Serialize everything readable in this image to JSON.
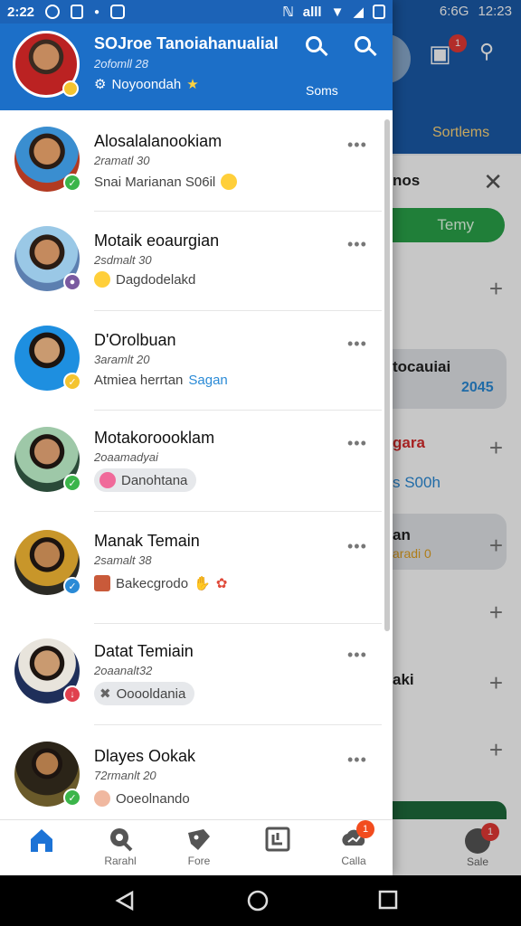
{
  "status_bar": {
    "time": "2:22",
    "right_text": "alll",
    "bg_time": "12:23",
    "bg_signal": "6:6G"
  },
  "header": {
    "title": "SOJroe Tanoiahanualial",
    "subtitle": "2ofomll 28",
    "status": "Noyoondah",
    "sort_label": "Soms"
  },
  "background": {
    "sort_label": "Sortlems",
    "panel_title": "nos",
    "green_pill": "Temy",
    "rows": [
      "tocauiai",
      "gara",
      "s S00h",
      "an",
      "aki"
    ],
    "row_years": [
      "2045",
      "aradi 0"
    ],
    "nav_label": "Sale",
    "badge_count": "1",
    "nav_badge": "1"
  },
  "chats": [
    {
      "name": "Alosalalanookiam",
      "time": "2ramatl 30",
      "preview": "Snai Marianan S06il",
      "preview_emoji": "sun-emoji",
      "badge_color": "#3bb54a",
      "preview_style": "plain",
      "avatar_bg": "#b23a22"
    },
    {
      "name": "Motaik eoaurgian",
      "time": "2sdmalt 30",
      "preview": "Dagdodelakd",
      "preview_emoji": "wink-emoji",
      "badge_color": "#7a5aa0",
      "preview_style": "plain",
      "avatar_bg": "#5c7fb0"
    },
    {
      "name": "D'Orolbuan",
      "time": "3aramlt 20",
      "preview_a": "Atmiea herrtan",
      "preview_b": "Sagan",
      "badge_color": "#f4c430",
      "preview_style": "mixed",
      "avatar_bg": "#1e8fe0"
    },
    {
      "name": "Motakoroooklam",
      "time": "2oaamadyai",
      "preview": "Danohtana",
      "preview_emoji": "heart-emoji",
      "badge_color": "#3bb54a",
      "preview_style": "pill",
      "avatar_bg": "#2a4a38"
    },
    {
      "name": "Manak Temain",
      "time": "2samalt 38",
      "preview": "Bakecgrodo",
      "preview_emoji": "person-emoji",
      "badge_color": "#2a8ad6",
      "preview_style": "plain",
      "avatar_bg": "#2b2a24"
    },
    {
      "name": "Datat Temiain",
      "time": "2oaanalt32",
      "preview": "Ooooldania",
      "preview_emoji": "wrench-emoji",
      "badge_color": "#e0404e",
      "preview_style": "pill",
      "avatar_bg": "#1f2f5a"
    },
    {
      "name": "Dlayes Ookak",
      "time": "72rmanlt 20",
      "preview": "Ooeolnando",
      "preview_emoji": "face-emoji",
      "badge_color": "#3bb54a",
      "preview_style": "plain",
      "avatar_bg": "#3a3020"
    }
  ],
  "nav": {
    "items": [
      {
        "label": "",
        "icon": "home-icon"
      },
      {
        "label": "Rarahl",
        "icon": "chat-icon"
      },
      {
        "label": "Fore",
        "icon": "tag-icon"
      },
      {
        "label": "",
        "icon": "book-icon"
      },
      {
        "label": "Calla",
        "icon": "cloud-icon",
        "badge": "1"
      }
    ]
  },
  "colors": {
    "header": "#1c6fc8",
    "accent": "#1c6fc8",
    "badge": "#f24c1e"
  }
}
